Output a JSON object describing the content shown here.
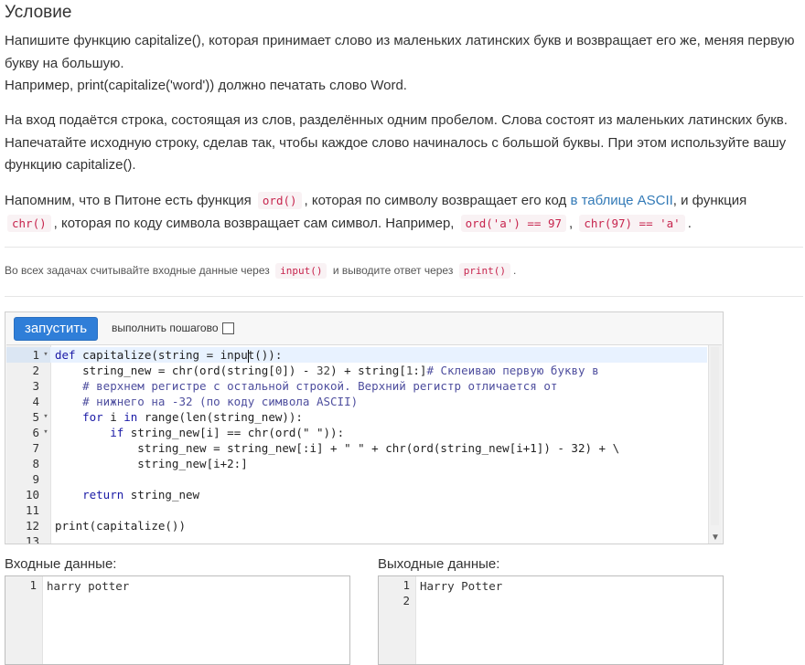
{
  "title": "Условие",
  "para1": {
    "line1": "Напишите функцию capitalize(), которая принимает слово из маленьких латинских букв и возвращает его же, меняя первую букву на большую.",
    "line2": "Например, print(capitalize('word')) должно печатать слово Word."
  },
  "para2": "На вход подаётся строка, состоящая из слов, разделённых одним пробелом. Слова состоят из маленьких латинских букв. Напечатайте исходную строку, сделав так, чтобы каждое слово начиналось с большой буквы. При этом используйте вашу функцию capitalize().",
  "para3": {
    "t1": "Напомним, что в Питоне есть функция",
    "c1": "ord()",
    "t2": ", которая по символу возвращает его код",
    "link": "в таблице ASCII",
    "t3": ", и функция",
    "c2": "chr()",
    "t4": ", которая по коду символа возвращает сам символ. Например,",
    "c3": "ord('a') == 97",
    "t5": ",",
    "c4": "chr(97) == 'a'",
    "t6": "."
  },
  "note": {
    "t1": "Во всех задачах считывайте входные данные через",
    "c1": "input()",
    "t2": "и выводите ответ через",
    "c2": "print()",
    "t3": "."
  },
  "editor": {
    "run_label": "запустить",
    "step_label": "выполнить пошагово",
    "step_checked": false,
    "lines": [
      {
        "n": "1",
        "fold": true
      },
      {
        "n": "2",
        "fold": false
      },
      {
        "n": "3",
        "fold": false
      },
      {
        "n": "4",
        "fold": false
      },
      {
        "n": "5",
        "fold": true
      },
      {
        "n": "6",
        "fold": true
      },
      {
        "n": "7",
        "fold": false
      },
      {
        "n": "8",
        "fold": false
      },
      {
        "n": "9",
        "fold": false
      },
      {
        "n": "10",
        "fold": false
      },
      {
        "n": "11",
        "fold": false
      },
      {
        "n": "12",
        "fold": false
      },
      {
        "n": "13",
        "fold": false
      }
    ],
    "code": {
      "l1_kw": "def",
      "l1_a": " capitalize(string = inpu",
      "l1_b": "t()):",
      "l2_a": "    string_new = chr(ord(string[",
      "l2_n1": "0",
      "l2_b": "]) - ",
      "l2_n2": "32",
      "l2_c": ") + string[",
      "l2_n3": "1",
      "l2_d": ":]",
      "l2_cm": "# Склеиваю первую букву в",
      "l3_cm": "    # верхнем регистре с остальной строкой. Верхний регистр отличается от",
      "l4_cm": "    # нижнего на -32 (по коду символа ASCII)",
      "l5_kw1": "for",
      "l5_a": " i ",
      "l5_kw2": "in",
      "l5_b": " range(len(string_new)):",
      "l6_kw": "if",
      "l6_a": " string_new[i] == chr(ord(\" \")):",
      "l7": "            string_new = string_new[:i] + \" \" + chr(ord(string_new[i+1]) - 32) + \\",
      "l8": "            string_new[i+2:]",
      "l10_kw": "return",
      "l10_a": " string_new",
      "l12": "print(capitalize())"
    }
  },
  "input": {
    "label": "Входные данные:",
    "lines": [
      {
        "n": "1",
        "text": "harry potter"
      }
    ]
  },
  "output": {
    "label": "Выходные данные:",
    "lines": [
      {
        "n": "1",
        "text": "Harry Potter"
      },
      {
        "n": "2",
        "text": ""
      }
    ]
  }
}
